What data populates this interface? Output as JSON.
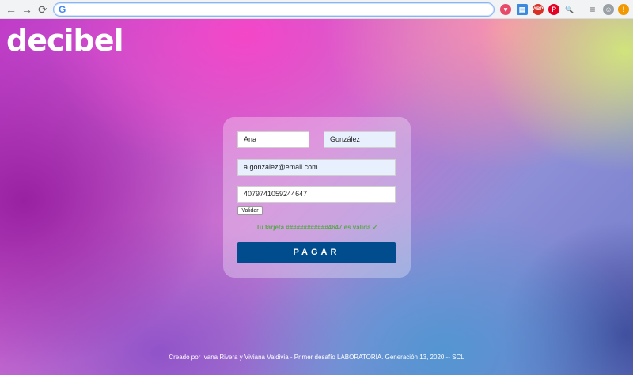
{
  "browser": {
    "back_icon": "←",
    "forward_icon": "→",
    "reload_icon": "⟳",
    "google_icon": "G",
    "extensions": [
      {
        "name": "heart",
        "glyph": "♥",
        "color": "#e84a6b"
      },
      {
        "name": "window",
        "glyph": "▤",
        "color": "#3c8ae0"
      },
      {
        "name": "adblock",
        "glyph": "ABP",
        "color": "#d93025"
      },
      {
        "name": "pinterest",
        "glyph": "P",
        "color": "#e60023"
      },
      {
        "name": "magnifier",
        "glyph": "🔍",
        "color": "#4a90d9"
      },
      {
        "name": "playlist",
        "glyph": "≡",
        "color": "#5f6368"
      },
      {
        "name": "avatar",
        "glyph": "☺",
        "color": "#9aa0a6"
      },
      {
        "name": "notification",
        "glyph": "!",
        "color": "#f29900"
      }
    ]
  },
  "header": {
    "logo": "decibel"
  },
  "form": {
    "first_name": "Ana",
    "last_name": "González",
    "email": "a.gonzalez@email.com",
    "card_number": "4079741059244647",
    "validate_label": "Validar",
    "validation_message": "Tu tarjeta ############4647 es válida ✓",
    "pay_label": "PAGAR"
  },
  "footer": {
    "text": "Creado por Ivana Rivera y Viviana Valdivia - Primer desafío LABORATORIA. Generación 13, 2020 -- SCL"
  },
  "colors": {
    "pay_button": "#004c8c",
    "success": "#5aa84a"
  }
}
